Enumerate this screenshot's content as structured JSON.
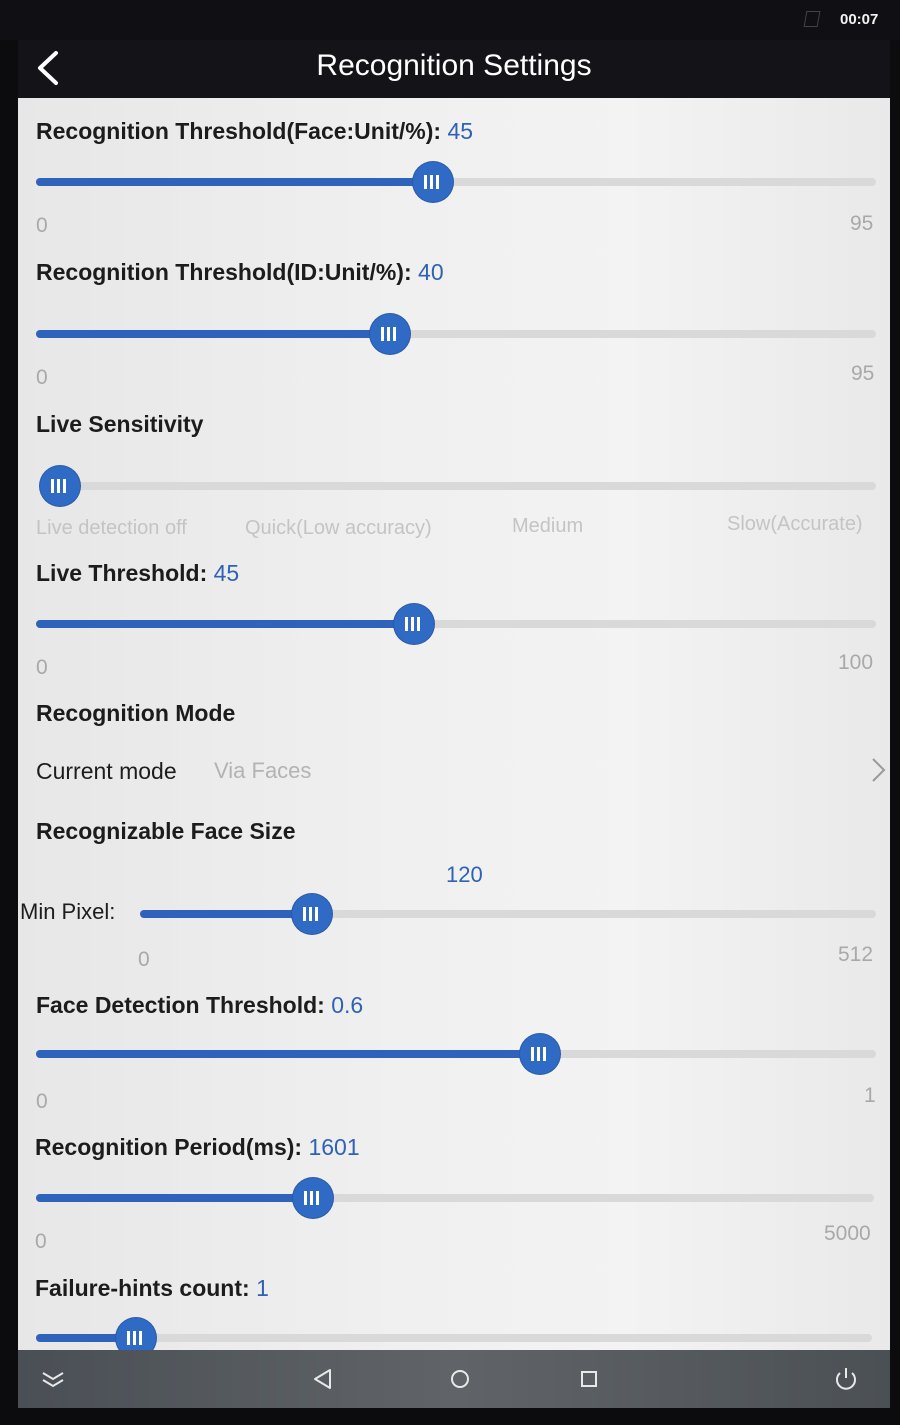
{
  "status_bar": {
    "time": "00:07"
  },
  "header": {
    "title": "Recognition Settings"
  },
  "settings": {
    "face_threshold": {
      "label": "Recognition Threshold(Face:Unit/%):",
      "value": "45",
      "min": "0",
      "max": "95",
      "fraction": 0.473
    },
    "id_threshold": {
      "label": "Recognition Threshold(ID:Unit/%):",
      "value": "40",
      "min": "0",
      "max": "95",
      "fraction": 0.421
    },
    "live_sensitivity": {
      "label": "Live Sensitivity",
      "options": [
        "Live detection off",
        "Quick(Low accuracy)",
        "Medium",
        "Slow(Accurate)"
      ],
      "selected_index": 0
    },
    "live_threshold": {
      "label": "Live Threshold:",
      "value": "45",
      "min": "0",
      "max": "100",
      "fraction": 0.45
    },
    "recognition_mode": {
      "label": "Recognition Mode",
      "row_label": "Current mode",
      "row_value": "Via Faces"
    },
    "face_size": {
      "label": "Recognizable Face Size",
      "value": "120",
      "sub_label": "Min Pixel:",
      "min": "0",
      "max": "512",
      "fraction": 0.234
    },
    "face_detection": {
      "label": "Face Detection Threshold:",
      "value": "0.6",
      "min": "0",
      "max": "1",
      "fraction": 0.6
    },
    "period": {
      "label": "Recognition Period(ms):",
      "value": "1601",
      "min": "0",
      "max": "5000",
      "fraction": 0.33
    },
    "failure_hints": {
      "label": "Failure-hints count:",
      "value": "1",
      "fraction": 0.12
    }
  },
  "colors": {
    "accent": "#2f6bc4",
    "track": "#d9d9d9",
    "value_text": "#2f62b5"
  }
}
